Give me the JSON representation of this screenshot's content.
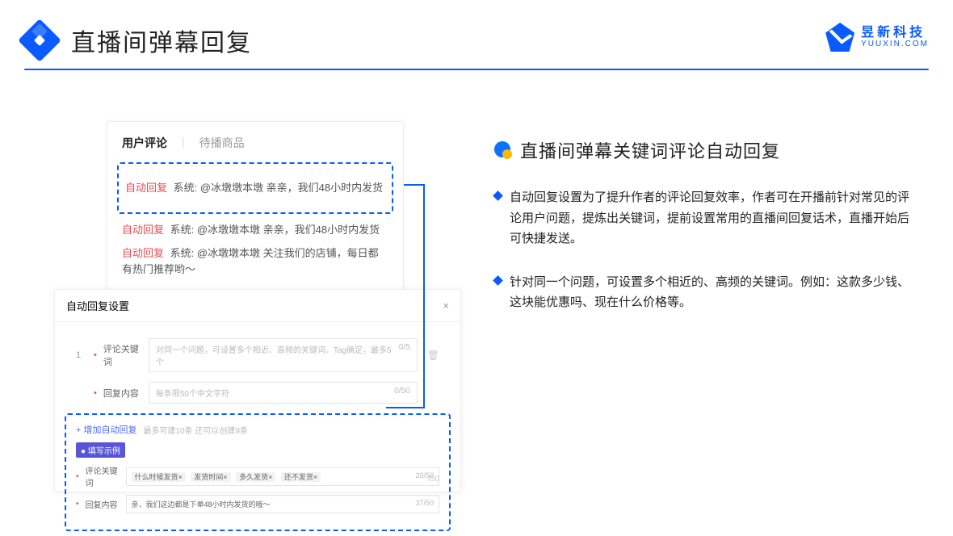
{
  "header": {
    "title": "直播间弹幕回复"
  },
  "brand": {
    "cn": "昱新科技",
    "en": "YUUXIN.COM"
  },
  "comments_panel": {
    "tabs": {
      "active": "用户评论",
      "inactive": "待播商品",
      "sep": "|"
    },
    "highlighted": "自动回复 系统: @冰墩墩本墩 亲亲，我们48小时内发货",
    "line2": "自动回复 系统: @冰墩墩本墩 亲亲，我们48小时内发货",
    "line3": "自动回复 系统: @冰墩墩本墩 关注我们的店铺，每日都有热门推荐哟～",
    "tag": "自动回复",
    "sys": "系统:"
  },
  "settings": {
    "title": "自动回复设置",
    "close": "×",
    "index": "1",
    "row1_label": "评论关键词",
    "row1_placeholder": "对同一个问题，可设置多个相近、高频的关键词。Tag确定，最多5个",
    "row1_count": "0/5",
    "row2_label": "回复内容",
    "row2_placeholder": "每条限50个中文字符",
    "row2_count": "0/50",
    "add_text": "+ 增加自动回复",
    "add_hint": "最多可建10条 还可以创建9条",
    "example_badge": "● 填写示例",
    "ex_row1_label": "评论关键词",
    "ex_chips": [
      "什么时候发货×",
      "发货时间×",
      "多久发货×",
      "还不发货×"
    ],
    "ex_row1_count": "20/50",
    "ex_row2_label": "回复内容",
    "ex_row2_value": "亲，我们这边都是下单48小时内发货的哦～",
    "ex_row2_count": "37/50",
    "tail_count": "/50"
  },
  "right": {
    "section_title": "直播间弹幕关键词评论自动回复",
    "points": [
      "自动回复设置为了提升作者的评论回复效率，作者可在开播前针对常见的评论用户问题，提炼出关键词，提前设置常用的直播间回复话术，直播开始后可快捷发送。",
      "针对同一个问题，可设置多个相近的、高频的关键词。例如：这款多少钱、这块能优惠吗、现在什么价格等。"
    ]
  }
}
